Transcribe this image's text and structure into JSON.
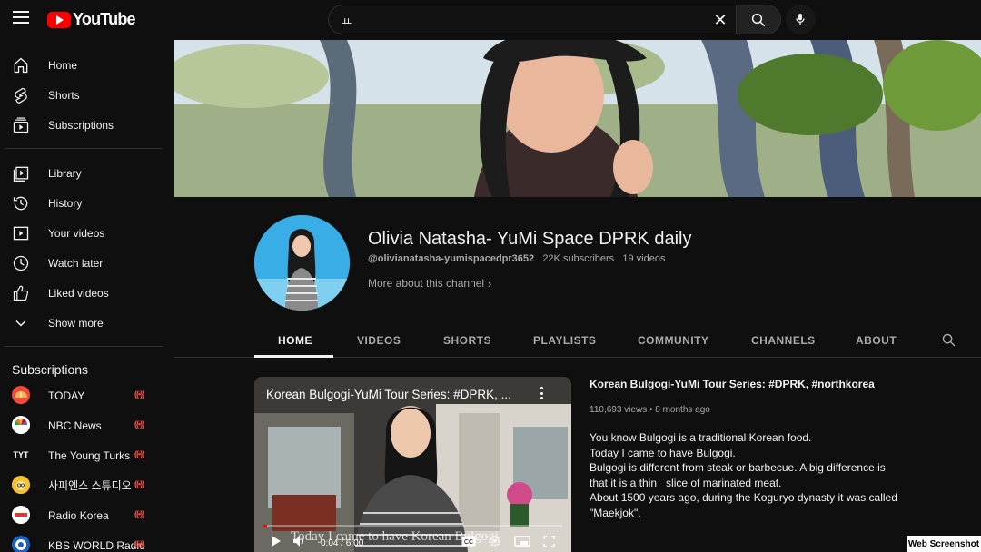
{
  "header": {
    "logo_text": "YouTube",
    "search_value": "ㅛ"
  },
  "sidebar": {
    "items": [
      {
        "label": "Home",
        "icon": "home-icon"
      },
      {
        "label": "Shorts",
        "icon": "shorts-icon"
      },
      {
        "label": "Subscriptions",
        "icon": "subscriptions-icon"
      },
      {
        "label": "Library",
        "icon": "library-icon"
      },
      {
        "label": "History",
        "icon": "history-icon"
      },
      {
        "label": "Your videos",
        "icon": "your-videos-icon"
      },
      {
        "label": "Watch later",
        "icon": "watch-later-icon"
      },
      {
        "label": "Liked videos",
        "icon": "liked-icon"
      },
      {
        "label": "Show more",
        "icon": "chevron-down-icon"
      }
    ],
    "subscriptions_heading": "Subscriptions",
    "subscriptions": [
      {
        "label": "TODAY",
        "avatar_color": "#ef4a3c",
        "live": true
      },
      {
        "label": "NBC News",
        "avatar_color": "#ffffff",
        "live": true
      },
      {
        "label": "The Young Turks",
        "avatar_text": "TYT",
        "avatar_color": "#0f0f0f",
        "live": true
      },
      {
        "label": "사피엔스 스튜디오",
        "avatar_color": "#f2c230",
        "live": true
      },
      {
        "label": "Radio Korea",
        "avatar_color": "#ffffff",
        "live": true
      },
      {
        "label": "KBS WORLD Radio",
        "avatar_color": "#1e5fbf",
        "live": true
      }
    ]
  },
  "channel": {
    "name": "Olivia Natasha- YuMi Space DPRK daily",
    "handle": "@olivianatasha-yumispacedpr3652",
    "subscribers": "22K subscribers",
    "videos": "19 videos",
    "more_about": "More about this channel"
  },
  "tabs": [
    "HOME",
    "VIDEOS",
    "SHORTS",
    "PLAYLISTS",
    "COMMUNITY",
    "CHANNELS",
    "ABOUT"
  ],
  "active_tab": "HOME",
  "featured": {
    "player_title": "Korean Bulgogi-YuMi Tour Series: #DPRK, ...",
    "caption": "Today I came to have Korean Bulgogi",
    "current_time": "0:04 / 6:00",
    "progress": 0.011,
    "title": "Korean Bulgogi-YuMi Tour Series: #DPRK, #northkorea",
    "meta": "110,693 views • 8 months ago",
    "description": [
      "You know Bulgogi is a traditional Korean food.",
      "Today I came to have Bulgogi.",
      "Bulgogi is different from steak or barbecue. A big difference is",
      "that it is a thin   slice of marinated meat.",
      "About 1500 years ago, during the Koguryo dynasty it was called",
      "\"Maekjok\"."
    ]
  },
  "watermark": "Web Screenshot"
}
